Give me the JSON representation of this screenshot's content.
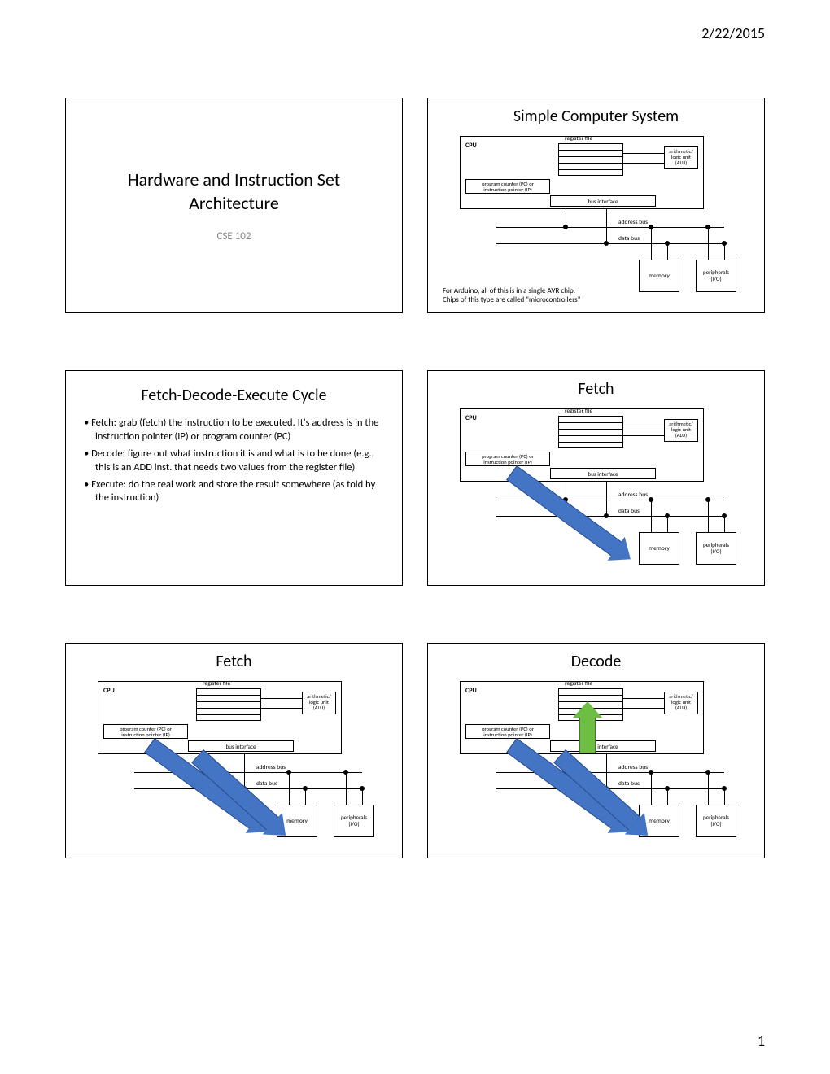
{
  "page": {
    "date": "2/22/2015",
    "number": "1"
  },
  "slide1": {
    "title_line1": "Hardware and Instruction Set",
    "title_line2": "Architecture",
    "subtitle": "CSE 102"
  },
  "slide2": {
    "title": "Simple Computer System",
    "note_line1": "For Arduino, all of this is in a single AVR chip.",
    "note_line2": "Chips of this type are called \"microcontrollers\""
  },
  "slide3": {
    "title": "Fetch-Decode-Execute Cycle",
    "bullets": [
      "Fetch: grab (fetch) the instruction to be executed.  It's address is in the instruction pointer (IP) or program counter (PC)",
      "Decode: figure out what instruction it is and what is to be done (e.g., this is an ADD inst. that needs two values from the register file)",
      "Execute: do the real work and store the result somewhere (as told by the instruction)"
    ]
  },
  "slide4": {
    "title": "Fetch"
  },
  "slide5": {
    "title": "Fetch"
  },
  "slide6": {
    "title": "Decode"
  },
  "diagram": {
    "cpu": "CPU",
    "regfile": "register file",
    "alu_line1": "arithmetic/",
    "alu_line2": "logic unit",
    "alu_line3": "(ALU)",
    "pc_line1": "program counter (PC) or",
    "pc_line2": "instruction pointer (IP)",
    "busif": "bus interface",
    "addrbus": "address bus",
    "databus": "data bus",
    "memory": "memory",
    "periph_line1": "peripherals",
    "periph_line2": "(I/O)"
  }
}
